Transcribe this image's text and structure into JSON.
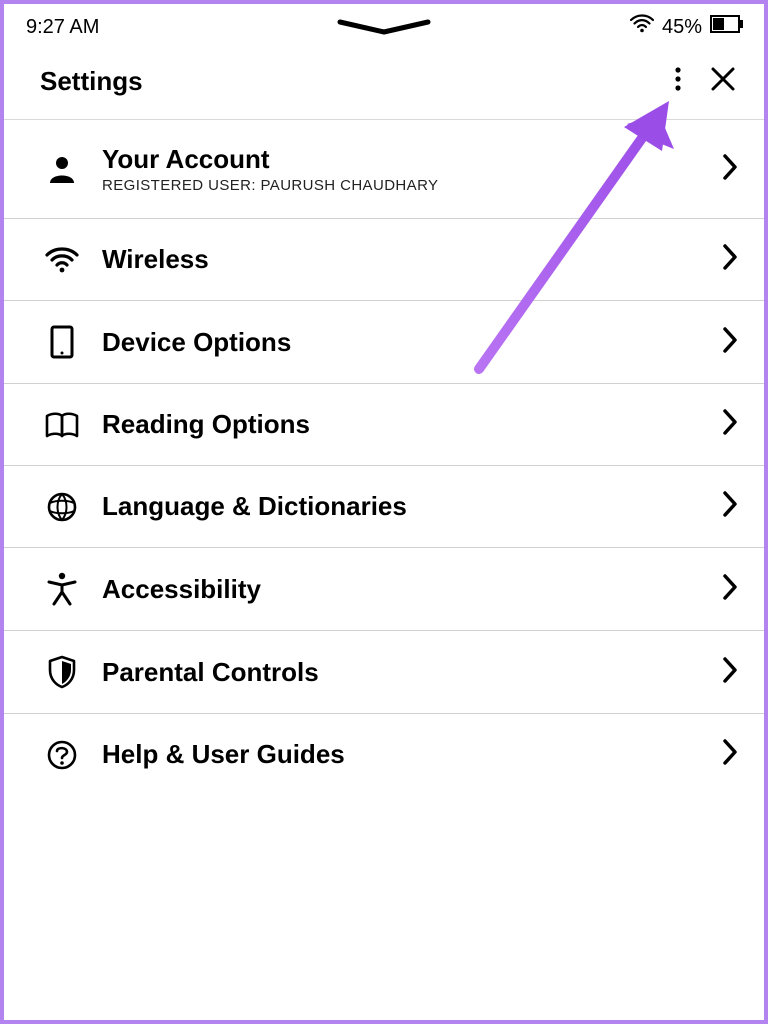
{
  "status": {
    "time": "9:27 AM",
    "battery_pct": "45%"
  },
  "header": {
    "title": "Settings"
  },
  "rows": {
    "account": {
      "title": "Your Account",
      "sub": "REGISTERED USER: PAURUSH CHAUDHARY"
    },
    "wireless": {
      "title": "Wireless"
    },
    "device": {
      "title": "Device Options"
    },
    "reading": {
      "title": "Reading Options"
    },
    "language": {
      "title": "Language & Dictionaries"
    },
    "accessibility": {
      "title": "Accessibility"
    },
    "parental": {
      "title": "Parental Controls"
    },
    "help": {
      "title": "Help & User Guides"
    }
  }
}
